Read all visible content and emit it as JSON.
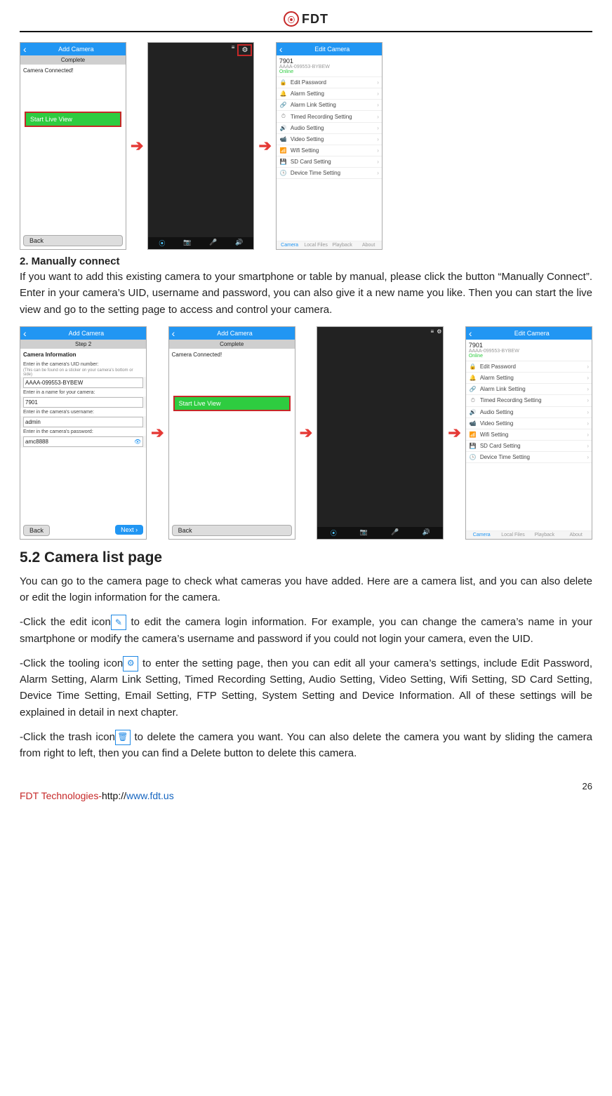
{
  "logo": "FDT",
  "row1": {
    "s1": {
      "bar": "Add Camera",
      "complete": "Complete",
      "connected": "Camera Connected!",
      "live": "Start Live View",
      "back": "Back"
    },
    "s2": {
      "settings_icon": "⚙"
    },
    "s3": {
      "bar": "Edit Camera",
      "name": "7901",
      "uid": "AAAA-099553-BYBEW",
      "status": "Online"
    }
  },
  "settings": [
    "Edit Password",
    "Alarm Setting",
    "Alarm Link Setting",
    "Timed Recording Setting",
    "Audio Setting",
    "Video Setting",
    "Wifi Setting",
    "SD Card Setting",
    "Device Time Setting"
  ],
  "tabs": [
    "Camera",
    "Local Files",
    "Playback",
    "About"
  ],
  "sec_title": "2. Manually connect",
  "para1": "If you want to add this existing camera to your smartphone or table by manual, please click the button “Manually Connect”. Enter in your camera’s UID, username and password, you can also give it a new name you like. Then you can start the live view and go to the setting page to access and control your camera.",
  "row2": {
    "s1": {
      "bar": "Add Camera",
      "step": "Step 2",
      "info": "Camera Information",
      "l1": "Enter in the camera's UID number:",
      "tiny": "(This can be found on a sticker on your camera's bottom or side)",
      "v1": "AAAA-099553-BYBEW",
      "l2": "Enter in a name for your camera:",
      "v2": "7901",
      "l3": "Enter in the camera's username:",
      "v3": "admin",
      "l4": "Enter in the camera's password:",
      "v4": "amc8888",
      "back": "Back",
      "next": "Next"
    },
    "s2": {
      "bar": "Add Camera",
      "complete": "Complete",
      "connected": "Camera Connected!",
      "live": "Start Live View",
      "back": "Back"
    },
    "s3": {
      "bar": "Edit Camera",
      "name": "7901",
      "uid": "AAAA-099553-BYBEW",
      "status": "Online"
    }
  },
  "h2": "5.2 Camera list page",
  "p2a": "You can go to the camera page to check what cameras you have added. Here are a camera list, and you can also delete or edit the login information for the camera.",
  "p2b_1": "-Click the edit icon",
  "p2b_2": " to edit the camera login information. For example, you can change the camera’s name in your smartphone or modify the camera’s username and password if you could not login your camera, even the UID.",
  "p2c_1": "-Click the tooling icon",
  "p2c_2": " to enter the setting page, then you can edit all your camera’s settings, include Edit Password, Alarm Setting, Alarm Link Setting, Timed Recording Setting, Audio Setting, Video Setting, Wifi Setting, SD Card Setting, Device Time Setting, Email Setting, FTP Setting, System Setting and Device Information. All of these settings will be explained in detail in next chapter.",
  "p2d_1": "-Click the trash icon",
  "p2d_2": " to delete the camera you want. You can also delete the camera you want by sliding the camera from right to left, then you can find a Delete button to delete this camera.",
  "footer": {
    "a": "FDT Technologies-",
    "b": "http://",
    "c": "www.fdt.us"
  },
  "page": "26",
  "icons": {
    "lock": "🔒",
    "bell": "🔔",
    "link": "🔗",
    "clock": "⏱",
    "audio": "🔊",
    "video": "📹",
    "wifi": "📶",
    "sd": "💾",
    "time": "🕒"
  }
}
